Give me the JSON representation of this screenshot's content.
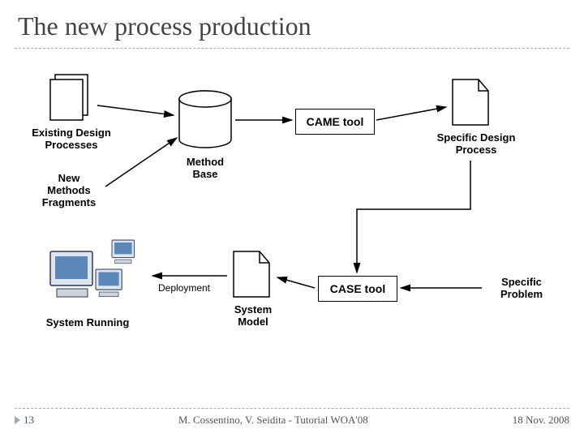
{
  "slide": {
    "title": "The new process production",
    "number": "13",
    "footer_center": "M. Cossentino, V. Seidita - Tutorial WOA'08",
    "footer_right": "18 Nov. 2008"
  },
  "diagram": {
    "existing_design_processes": "Existing Design\nProcesses",
    "new_methods_fragments": "New\nMethods\nFragments",
    "method_base": "Method\nBase",
    "came_tool": "CAME tool",
    "specific_design_process": "Specific Design\nProcess",
    "specific_problem": "Specific\nProblem",
    "case_tool": "CASE tool",
    "system_model": "System\nModel",
    "deployment": "Deployment",
    "system_running": "System Running"
  },
  "chart_data": {
    "type": "diagram",
    "title": "The new process production",
    "nodes": [
      {
        "id": "existing_design_processes",
        "label": "Existing Design Processes",
        "kind": "document-stack"
      },
      {
        "id": "new_methods_fragments",
        "label": "New Methods Fragments",
        "kind": "text"
      },
      {
        "id": "method_base",
        "label": "Method Base",
        "kind": "datastore"
      },
      {
        "id": "came_tool",
        "label": "CAME tool",
        "kind": "process-box"
      },
      {
        "id": "specific_design_process",
        "label": "Specific Design Process",
        "kind": "document"
      },
      {
        "id": "specific_problem",
        "label": "Specific Problem",
        "kind": "text"
      },
      {
        "id": "case_tool",
        "label": "CASE tool",
        "kind": "process-box"
      },
      {
        "id": "system_model",
        "label": "System Model",
        "kind": "document"
      },
      {
        "id": "deployment",
        "label": "Deployment",
        "kind": "edge-label"
      },
      {
        "id": "system_running",
        "label": "System Running",
        "kind": "computers"
      }
    ],
    "edges": [
      {
        "from": "existing_design_processes",
        "to": "method_base"
      },
      {
        "from": "new_methods_fragments",
        "to": "method_base"
      },
      {
        "from": "method_base",
        "to": "came_tool"
      },
      {
        "from": "came_tool",
        "to": "specific_design_process"
      },
      {
        "from": "specific_design_process",
        "to": "case_tool"
      },
      {
        "from": "specific_problem",
        "to": "case_tool"
      },
      {
        "from": "case_tool",
        "to": "system_model"
      },
      {
        "from": "system_model",
        "to": "system_running",
        "label": "Deployment"
      }
    ]
  }
}
